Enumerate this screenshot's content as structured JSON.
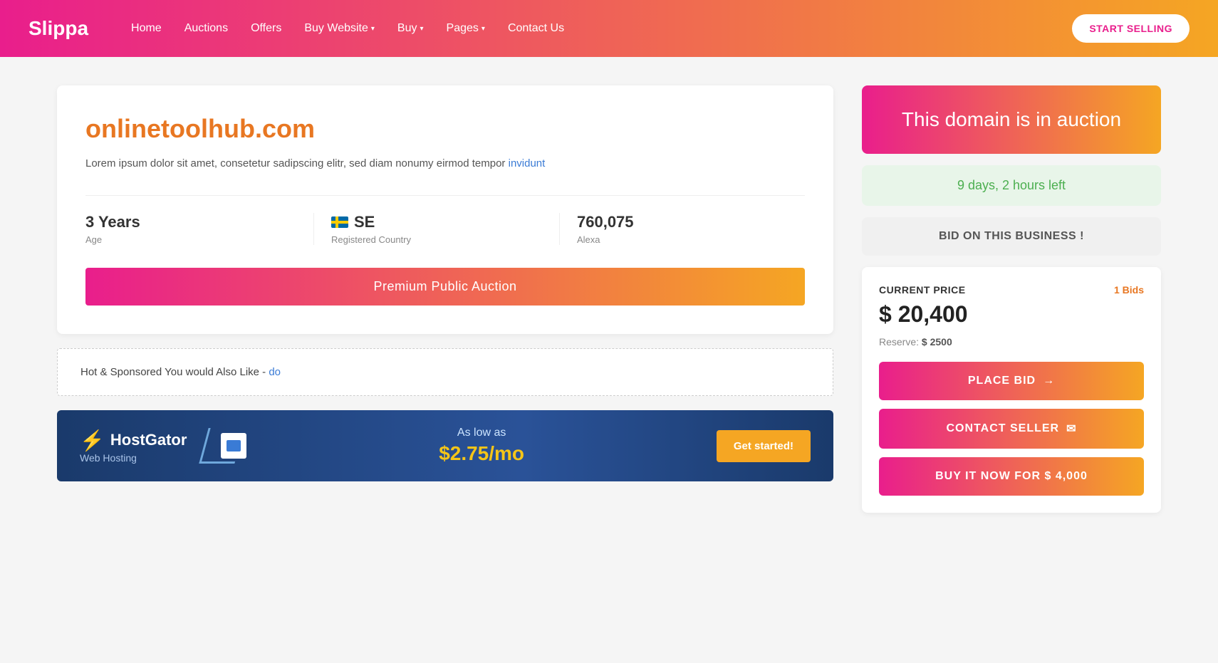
{
  "header": {
    "logo": "Slippa",
    "nav": [
      {
        "label": "Home",
        "hasDropdown": false
      },
      {
        "label": "Auctions",
        "hasDropdown": false
      },
      {
        "label": "Offers",
        "hasDropdown": false
      },
      {
        "label": "Buy Website",
        "hasDropdown": true
      },
      {
        "label": "Buy",
        "hasDropdown": true
      },
      {
        "label": "Pages",
        "hasDropdown": true
      },
      {
        "label": "Contact Us",
        "hasDropdown": false
      }
    ],
    "cta": "START SELLING"
  },
  "domain": {
    "name": "onlinetoolhub.com",
    "description": "Lorem ipsum dolor sit amet, consetetur sadipscing elitr, sed diam nonumy eirmod tempor invidunt",
    "description_link": "invidunt",
    "stats": {
      "age": "3 Years",
      "age_label": "Age",
      "country_code": "SE",
      "country_label": "Registered Country",
      "alexa": "760,075",
      "alexa_label": "Alexa"
    },
    "auction_badge": "Premium Public Auction"
  },
  "sponsored": {
    "text": "Hot & Sponsored You would Also Like - do"
  },
  "hostgator": {
    "logo_name": "HostGator",
    "logo_sub": "Web Hosting",
    "deal_text": "As low as",
    "price": "$2.75/mo",
    "cta": "Get started!"
  },
  "sidebar": {
    "auction_title": "This domain is in auction",
    "time_left": "9 days, 2 hours left",
    "bid_business": "BID ON THIS BUSINESS !",
    "current_price_label": "CURRENT PRICE",
    "bids": "1 Bids",
    "price": "$ 20,400",
    "reserve_label": "Reserve:",
    "reserve_price": "$ 2500",
    "place_bid": "PLACE BID",
    "contact_seller": "CONTACT SELLER",
    "buy_now": "BUY IT NOW FOR $ 4,000",
    "arrow": "→",
    "envelope": "✉"
  }
}
